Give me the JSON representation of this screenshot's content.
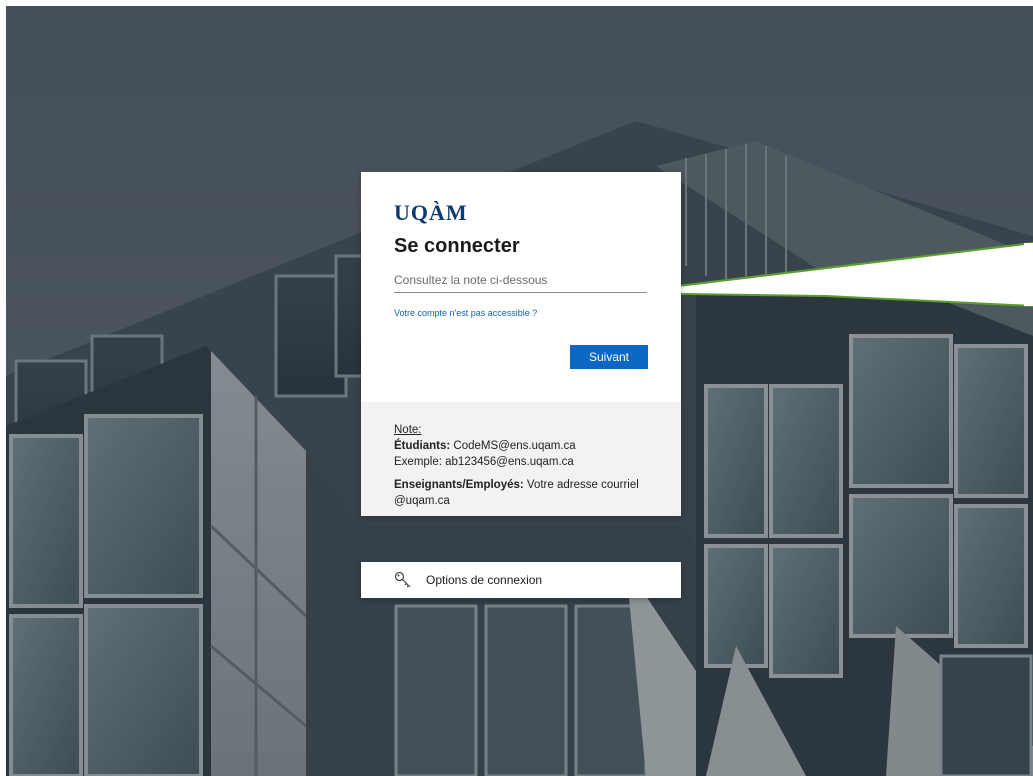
{
  "logo": {
    "text": "UQÀM"
  },
  "login": {
    "title": "Se connecter",
    "input_placeholder": "Consultez la note ci-dessous",
    "input_value": "",
    "account_link": "Votre compte n'est pas accessible ?",
    "next_button": "Suivant"
  },
  "note": {
    "heading": "Note:",
    "students_label": "Étudiants:",
    "students_value": " CodeMS@ens.uqam.ca",
    "students_example": "Exemple: ab123456@ens.uqam.ca",
    "staff_label": "Enseignants/Employés:",
    "staff_value": " Votre adresse courriel @uqam.ca"
  },
  "options": {
    "label": "Options de connexion",
    "icon": "key-icon"
  },
  "colors": {
    "brand": "#0d3a75",
    "button": "#0b67c2",
    "link": "#0b62b8",
    "callout_stroke": "#5a9e2e"
  }
}
